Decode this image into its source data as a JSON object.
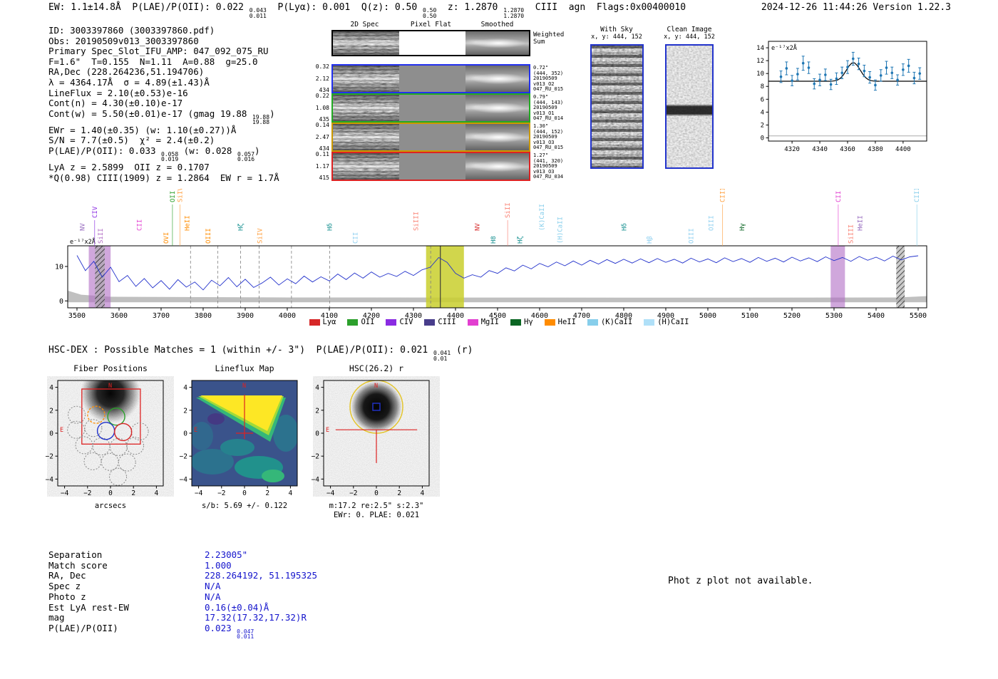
{
  "header": {
    "segments": [
      {
        "t": "EW: 1.1±14.8Å  P(LAE)/P(OII): 0.022 "
      },
      {
        "hi": "0.043",
        "lo": "0.011"
      },
      {
        "t": "  P(Lyα): 0.001  Q(z): 0.50 "
      },
      {
        "hi": "0.50",
        "lo": "0.50"
      },
      {
        "t": "  z: 1.2870 "
      },
      {
        "hi": "1.2870",
        "lo": "1.2870"
      },
      {
        "t": "  CIII  agn  Flags:0x00400010"
      }
    ],
    "datetime_version": "2024-12-26 11:44:26  Version 1.22.3"
  },
  "info": {
    "lines": [
      [
        {
          "t": "ID: 3003397860 (3003397860.pdf)"
        }
      ],
      [
        {
          "t": "Obs: 20190509v013_3003397860"
        }
      ],
      [
        {
          "t": "Primary Spec_Slot_IFU_AMP: 047_092_075_RU"
        }
      ],
      [
        {
          "t": "F=1.6\"  T=0.155  N=1.11  A=0.88  g=25.0"
        }
      ],
      [
        {
          "t": "RA,Dec (228.264236,51.194706)"
        }
      ],
      [
        {
          "t": "λ = 4364.17Å  σ = 4.89(±1.43)Å"
        }
      ],
      [
        {
          "t": "LineFlux = 2.10(±0.53)e-16"
        }
      ],
      [
        {
          "t": "Cont(n) = 4.30(±0.10)e-17"
        }
      ],
      [
        {
          "t": "Cont(w) = 5.50(±0.01)e-17 (gmag 19.88 "
        },
        {
          "hi": "19.88",
          "lo": "19.88"
        },
        {
          "t": ")"
        }
      ],
      [
        {
          "t": "EWr = 1.40(±0.35) (w: 1.10(±0.27))Å"
        }
      ],
      [
        {
          "t": "S/N = 7.7(±0.5)  χ² = 2.4(±0.2)"
        }
      ],
      [
        {
          "t": "P(LAE)/P(OII): 0.033 "
        },
        {
          "hi": "0.058",
          "lo": "0.019"
        },
        {
          "t": " (w: 0.028 "
        },
        {
          "hi": "0.057",
          "lo": "0.016"
        },
        {
          "t": ")"
        }
      ],
      [
        {
          "t": "LyA z = 2.5899  OII z = 0.1707"
        }
      ],
      [
        {
          "t": "*Q(0.98) CIII(1909) z = 1.2864  EW r = 1.7Å"
        }
      ]
    ]
  },
  "cutouts": {
    "col_titles": [
      "2D Spec",
      "Pixel Flat",
      "Smoothed"
    ],
    "weighted": {
      "border": "#000000",
      "note": [
        "Weighted",
        "Sum"
      ]
    },
    "rows": [
      {
        "border": "#2230ee",
        "left": [
          "0.32",
          "2.12",
          "434"
        ],
        "note": [
          "0.72\"",
          "(444, 352)",
          "20190509",
          "v013_O2",
          "047_RU_015"
        ]
      },
      {
        "border": "#22aa22",
        "left": [
          "0.22",
          "1.08",
          "435"
        ],
        "note": [
          "0.79\"",
          "(444, 143)",
          "20190509",
          "v013_O1",
          "047_RU_014"
        ]
      },
      {
        "border": "#cc9900",
        "left": [
          "0.14",
          "2.47",
          "434"
        ],
        "note": [
          "1.30\"",
          "(444, 152)",
          "20190509",
          "v013_O3",
          "047_RU_015"
        ]
      },
      {
        "border": "#dd2222",
        "left": [
          "0.11",
          "1.17",
          "415"
        ],
        "note": [
          "1.27\"",
          "(441, 320)",
          "20190509",
          "v013_O3",
          "047_RU_034"
        ]
      }
    ]
  },
  "stamps": {
    "withsky_title": "With Sky",
    "withsky_sub": "x, y: 444, 152",
    "clean_title": "Clean Image",
    "clean_sub": "x, y: 444, 152"
  },
  "hsc": {
    "segments": [
      {
        "t": "HSC-DEX : Possible Matches = 1 (within +/- 3\")  P(LAE)/P(OII): 0.021 "
      },
      {
        "hi": "0.041",
        "lo": "0.01"
      },
      {
        "t": " (r)"
      }
    ]
  },
  "match_table": {
    "rows": [
      {
        "label": "Separation",
        "value": [
          {
            "t": "2.23005\""
          }
        ]
      },
      {
        "label": "Match score",
        "value": [
          {
            "t": "1.000"
          }
        ]
      },
      {
        "label": "RA, Dec",
        "value": [
          {
            "t": "228.264192, 51.195325"
          }
        ]
      },
      {
        "label": "Spec z",
        "value": [
          {
            "t": "N/A"
          }
        ]
      },
      {
        "label": "Photo z",
        "value": [
          {
            "t": "N/A"
          }
        ]
      },
      {
        "label": "Est LyA rest-EW",
        "value": [
          {
            "t": "0.16(±0.04)Å"
          }
        ]
      },
      {
        "label": "mag",
        "value": [
          {
            "t": "17.32(17.32,17.32)R"
          }
        ]
      },
      {
        "label": "P(LAE)/P(OII)",
        "value": [
          {
            "t": "0.023 "
          },
          {
            "hi": "0.047",
            "lo": "0.011"
          }
        ]
      }
    ]
  },
  "photz_note": "Phot z plot not available.",
  "chart_data": [
    {
      "id": "line_fit_zoom",
      "type": "scatter",
      "annotation": "e⁻¹⁷x2Å",
      "xlim": [
        4303,
        4417
      ],
      "ylim": [
        -0.5,
        15
      ],
      "xticks": [
        4320,
        4340,
        4360,
        4380,
        4400
      ],
      "yticks": [
        0,
        2,
        4,
        6,
        8,
        10,
        12,
        14
      ],
      "points": {
        "x": [
          4312,
          4316,
          4320,
          4324,
          4328,
          4332,
          4336,
          4340,
          4344,
          4348,
          4352,
          4356,
          4360,
          4364,
          4368,
          4372,
          4376,
          4380,
          4384,
          4388,
          4392,
          4396,
          4400,
          4404,
          4408,
          4412
        ],
        "y": [
          9.5,
          10.8,
          8.9,
          9.9,
          11.6,
          10.9,
          8.4,
          9.0,
          9.8,
          8.3,
          9.2,
          10.1,
          11.0,
          12.3,
          11.5,
          10.4,
          9.4,
          8.2,
          9.7,
          10.9,
          10.1,
          9.0,
          10.6,
          11.2,
          9.3,
          10.0
        ],
        "yerr": [
          0.9,
          1.0,
          0.8,
          0.9,
          1.1,
          0.9,
          0.8,
          0.9,
          0.9,
          0.8,
          0.9,
          0.9,
          1.0,
          1.0,
          0.9,
          0.9,
          0.9,
          0.8,
          0.9,
          1.0,
          0.9,
          0.8,
          0.9,
          1.0,
          0.9,
          0.9
        ]
      },
      "fit": {
        "type": "gaussian",
        "center": 4364.17,
        "sigma": 4.89,
        "amplitude": 2.9,
        "baseline": 8.8
      }
    },
    {
      "id": "full_spectrum",
      "type": "line",
      "annotation": "e⁻¹⁷x2Å",
      "xlim": [
        3478,
        5520
      ],
      "ylim": [
        -2,
        16
      ],
      "xticks": [
        3500,
        3600,
        3700,
        3800,
        3900,
        4000,
        4100,
        4200,
        4300,
        4400,
        4500,
        4600,
        4700,
        4800,
        4900,
        5000,
        5100,
        5200,
        5300,
        5400,
        5500
      ],
      "yticks": [
        0,
        10
      ],
      "x_start": 3500,
      "x_step": 20,
      "y": [
        13.2,
        8.8,
        11.5,
        6.9,
        9.8,
        5.6,
        7.4,
        4.2,
        6.5,
        3.8,
        5.9,
        3.4,
        6.2,
        4.0,
        5.5,
        3.2,
        6.0,
        4.4,
        6.8,
        4.1,
        6.3,
        3.9,
        5.2,
        6.9,
        4.6,
        6.4,
        5.0,
        7.2,
        5.5,
        7.0,
        5.8,
        7.8,
        6.2,
        8.1,
        6.6,
        8.4,
        6.9,
        8.0,
        7.1,
        8.6,
        7.4,
        9.0,
        9.8,
        12.6,
        11.2,
        8.0,
        6.6,
        7.6,
        6.9,
        8.8,
        8.0,
        9.6,
        8.7,
        10.4,
        9.3,
        10.9,
        9.9,
        11.3,
        10.2,
        11.6,
        10.4,
        11.8,
        10.7,
        12.0,
        10.9,
        12.1,
        11.0,
        12.2,
        11.1,
        12.3,
        11.2,
        12.1,
        11.0,
        12.4,
        11.3,
        12.2,
        11.1,
        12.5,
        11.4,
        12.3,
        11.2,
        12.6,
        11.5,
        12.4,
        11.3,
        12.7,
        11.6,
        12.5,
        11.4,
        12.8,
        11.7,
        12.6,
        11.5,
        12.9,
        11.8,
        12.7,
        11.6,
        13.0,
        11.9,
        12.8,
        13.1
      ],
      "marker_line": 4364,
      "highlight_bands": [
        {
          "x0": 4330,
          "x1": 4420,
          "color": "#c9cf2d",
          "alpha": 0.85
        },
        {
          "x0": 3528,
          "x1": 3580,
          "color": "#b06cc4",
          "alpha": 0.6
        },
        {
          "x0": 5292,
          "x1": 5326,
          "color": "#b06cc4",
          "alpha": 0.6
        }
      ],
      "hatch_bands": [
        {
          "x0": 3543,
          "x1": 3566
        },
        {
          "x0": 5448,
          "x1": 5468
        }
      ],
      "dashed_lines": [
        3770,
        3835,
        3889,
        3933,
        4010,
        4101,
        4341
      ],
      "line_labels": [
        {
          "wl": 3513,
          "text": "NV",
          "color": "#9467bd",
          "tier": 2
        },
        {
          "wl": 3542,
          "text": "CIV",
          "color": "#8a2be2",
          "tier": 3
        },
        {
          "wl": 3556,
          "text": "SiII",
          "color": "#b06cc4",
          "tier": 1
        },
        {
          "wl": 3648,
          "text": "CII",
          "color": "#e23fd0",
          "tier": 2
        },
        {
          "wl": 3712,
          "text": "OVI",
          "color": "#ff8c00",
          "tier": 1
        },
        {
          "wl": 3727,
          "text": "OII",
          "color": "#2ca02c",
          "tier": 4
        },
        {
          "wl": 3745,
          "text": "SiIV",
          "color": "#ffa040",
          "tier": 4
        },
        {
          "wl": 3762,
          "text": "HeII",
          "color": "#ff8c00",
          "tier": 2
        },
        {
          "wl": 3812,
          "text": "OIII",
          "color": "#ff8c00",
          "tier": 1
        },
        {
          "wl": 3889,
          "text": "Hζ",
          "color": "#159090",
          "tier": 2
        },
        {
          "wl": 3935,
          "text": "SiIV",
          "color": "#ffa040",
          "tier": 1
        },
        {
          "wl": 4101,
          "text": "Hδ",
          "color": "#159090",
          "tier": 2
        },
        {
          "wl": 4162,
          "text": "CII",
          "color": "#8fd0f0",
          "tier": 1
        },
        {
          "wl": 4306,
          "text": "SiIII",
          "color": "#fa8072",
          "tier": 2
        },
        {
          "wl": 4452,
          "text": "NV",
          "color": "#d62728",
          "tier": 2
        },
        {
          "wl": 4490,
          "text": "H8",
          "color": "#159090",
          "tier": 1
        },
        {
          "wl": 4524,
          "text": "SiII",
          "color": "#fa8072",
          "tier": 3
        },
        {
          "wl": 4553,
          "text": "Hζ",
          "color": "#159090",
          "tier": 1
        },
        {
          "wl": 4605,
          "text": "(K)CaII",
          "color": "#87ceeb",
          "tier": 2
        },
        {
          "wl": 4648,
          "text": "(H)CaII",
          "color": "#87ceeb",
          "tier": 1
        },
        {
          "wl": 4801,
          "text": "Hδ",
          "color": "#159090",
          "tier": 2
        },
        {
          "wl": 4861,
          "text": "Hβ",
          "color": "#8fd0f0",
          "tier": 1
        },
        {
          "wl": 4960,
          "text": "OIII",
          "color": "#8fd0f0",
          "tier": 1
        },
        {
          "wl": 5008,
          "text": "OIII",
          "color": "#8fd0f0",
          "tier": 2
        },
        {
          "wl": 5035,
          "text": "CIII",
          "color": "#ffa040",
          "tier": 4
        },
        {
          "wl": 5081,
          "text": "Hγ",
          "color": "#0b6623",
          "tier": 2
        },
        {
          "wl": 5310,
          "text": "CII",
          "color": "#e23fd0",
          "tier": 4
        },
        {
          "wl": 5340,
          "text": "SiIII",
          "color": "#fa8072",
          "tier": 1
        },
        {
          "wl": 5362,
          "text": "HeII",
          "color": "#9467bd",
          "tier": 2
        },
        {
          "wl": 5497,
          "text": "CIII",
          "color": "#87ceeb",
          "tier": 4
        }
      ],
      "legend": [
        {
          "label": "Lyα",
          "color": "#d62728"
        },
        {
          "label": "OII",
          "color": "#2ca02c"
        },
        {
          "label": "CIV",
          "color": "#8a2be2"
        },
        {
          "label": "CIII",
          "color": "#483d8b"
        },
        {
          "label": "MgII",
          "color": "#e23fd0"
        },
        {
          "label": "Hγ",
          "color": "#0b6623"
        },
        {
          "label": "HeII",
          "color": "#ff8c00"
        },
        {
          "label": "(K)CaII",
          "color": "#87ceeb"
        },
        {
          "label": "(H)CaII",
          "color": "#b0e0f8"
        }
      ]
    },
    {
      "id": "fiber_positions",
      "type": "image",
      "title": "Fiber Positions",
      "xlabel": "arcsecs",
      "ticks": [
        -4,
        -2,
        0,
        2,
        4
      ],
      "north_label": "N",
      "east_label": "E"
    },
    {
      "id": "lineflux_map",
      "type": "heatmap",
      "title": "Lineflux Map",
      "xlabel": "s/b: 5.69 +/- 0.122",
      "ticks": [
        -4,
        -2,
        0,
        2,
        4
      ],
      "north_label": "N",
      "east_label": "E"
    },
    {
      "id": "hsc_r",
      "type": "image",
      "title": "HSC(26.2) r",
      "xlabel": "m:17.2  re:2.5\"  s:2.3\"",
      "xlabel2": "EWr: 0. PLAE: 0.021",
      "ticks": [
        -4,
        -2,
        0,
        2,
        4
      ],
      "north_label": "N",
      "east_label": "E"
    }
  ]
}
